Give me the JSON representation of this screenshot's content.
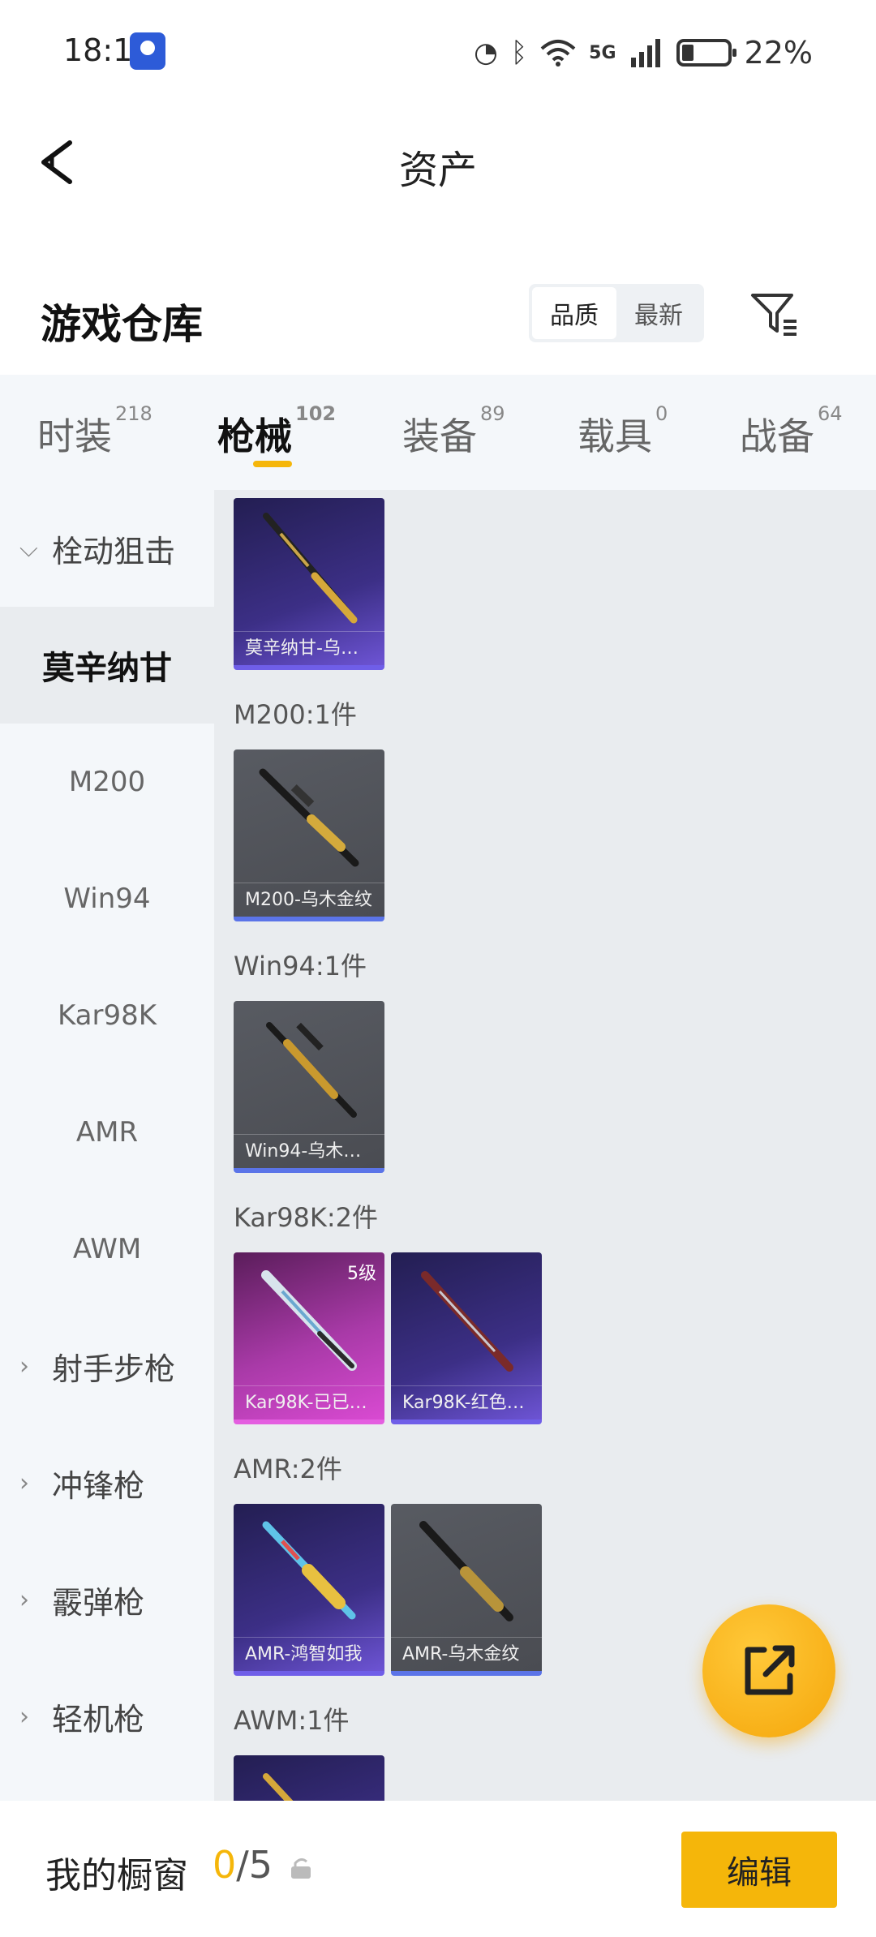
{
  "status_bar": {
    "time": "18:11",
    "network": "5G",
    "battery": "22%"
  },
  "nav": {
    "title": "资产"
  },
  "warehouse": {
    "title": "游戏仓库",
    "sort_options": [
      "品质",
      "最新"
    ],
    "sort_selected": "品质"
  },
  "tabs": [
    {
      "label": "时装",
      "count": "218"
    },
    {
      "label": "枪械",
      "count": "102"
    },
    {
      "label": "装备",
      "count": "89"
    },
    {
      "label": "载具",
      "count": "0"
    },
    {
      "label": "战备",
      "count": "64"
    }
  ],
  "active_tab": "枪械",
  "sidebar": {
    "group_open": "栓动狙击",
    "selected_item": "莫辛纳甘",
    "sub_items": [
      "M200",
      "Win94",
      "Kar98K",
      "AMR",
      "AWM"
    ],
    "collapsed_groups": [
      "射手步枪",
      "冲锋枪",
      "霰弹枪",
      "轻机枪"
    ]
  },
  "groups": [
    {
      "label": "",
      "cards": [
        {
          "name": "莫辛纳甘-乌…",
          "rarity": "purple"
        }
      ]
    },
    {
      "label": "M200:1件",
      "cards": [
        {
          "name": "M200-乌木金纹",
          "rarity": "gray"
        }
      ]
    },
    {
      "label": "Win94:1件",
      "cards": [
        {
          "name": "Win94-乌木…",
          "rarity": "gray"
        }
      ]
    },
    {
      "label": "Kar98K:2件",
      "cards": [
        {
          "name": "Kar98K-已已…",
          "rarity": "pink",
          "badge": "5级"
        },
        {
          "name": "Kar98K-红色…",
          "rarity": "purple"
        }
      ]
    },
    {
      "label": "AMR:2件",
      "cards": [
        {
          "name": "AMR-鸿智如我",
          "rarity": "purple"
        },
        {
          "name": "AMR-乌木金纹",
          "rarity": "gray"
        }
      ]
    },
    {
      "label": "AWM:1件",
      "cards": [
        {
          "name": "",
          "rarity": "purple"
        }
      ]
    }
  ],
  "bottom_bar": {
    "showcase_label": "我的橱窗",
    "showcase_current": "0",
    "showcase_total": "/5",
    "edit_label": "编辑"
  },
  "colors": {
    "accent": "#f5b60a",
    "purple_rarity": "#6f5ee8",
    "pink_rarity": "#e45ee0",
    "gray_rarity": "#5b74e8"
  }
}
